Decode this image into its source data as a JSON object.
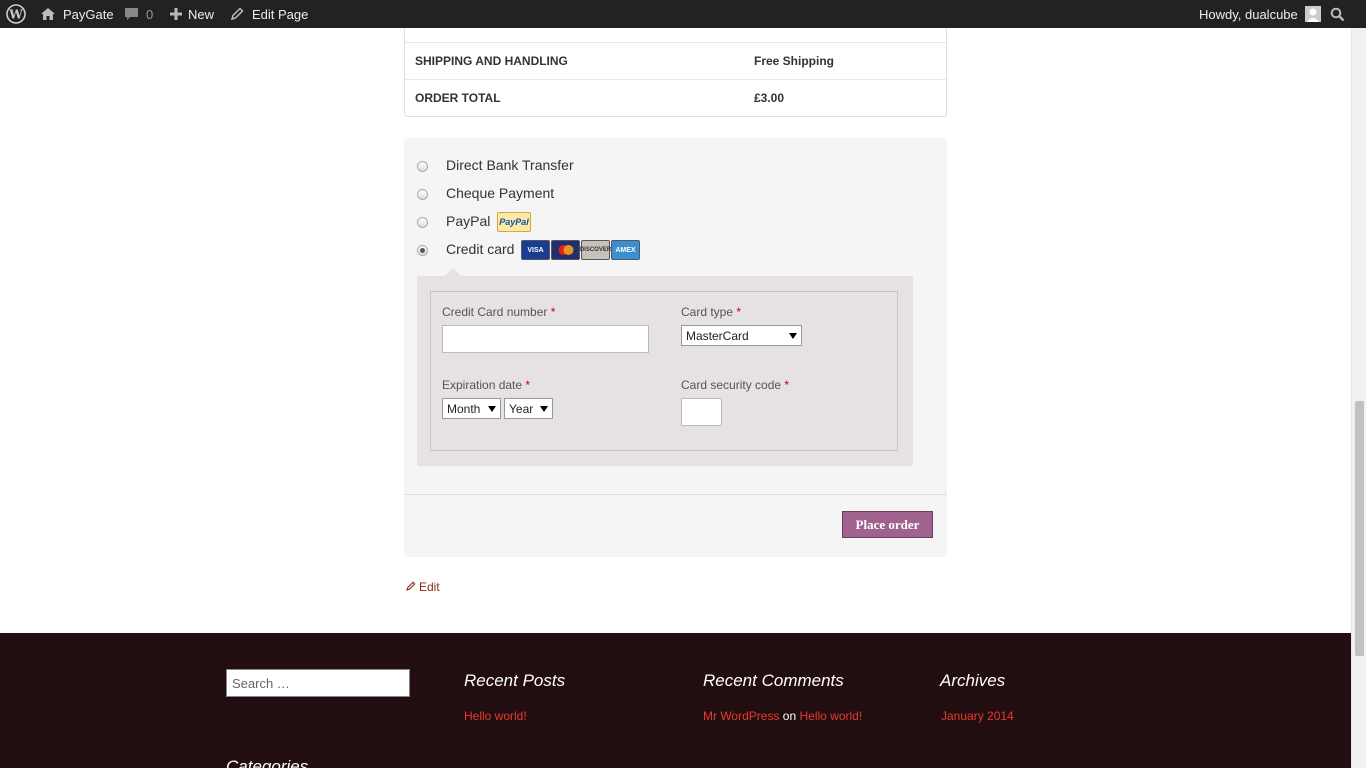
{
  "admin_bar": {
    "site_name": "PayGate",
    "comments_count": "0",
    "new_label": "New",
    "edit_page_label": "Edit Page",
    "greeting": "Howdy, dualcube"
  },
  "order_table": {
    "rows": [
      {
        "label": "SHIPPING AND HANDLING",
        "value": "Free Shipping"
      },
      {
        "label": "ORDER TOTAL",
        "value": "£3.00"
      }
    ]
  },
  "payment": {
    "methods": [
      {
        "label": "Direct Bank Transfer",
        "selected": false
      },
      {
        "label": "Cheque Payment",
        "selected": false
      },
      {
        "label": "PayPal",
        "selected": false
      },
      {
        "label": "Credit card",
        "selected": true
      }
    ],
    "paypal_logo_text": "PayPal",
    "card_logos": [
      "VISA",
      "MC",
      "DISCOVER",
      "AMEX"
    ],
    "credit_card_form": {
      "card_number_label": "Credit Card number",
      "card_number_value": "",
      "card_type_label": "Card type",
      "card_type_value": "MasterCard",
      "expiration_label": "Expiration date",
      "month_value": "Month",
      "year_value": "Year",
      "security_code_label": "Card security code",
      "security_code_value": "",
      "required_mark": "*"
    },
    "place_order_label": "Place order"
  },
  "edit_link_label": "Edit",
  "footer": {
    "search_placeholder": "Search …",
    "recent_posts_title": "Recent Posts",
    "recent_posts": [
      "Hello world!"
    ],
    "recent_comments_title": "Recent Comments",
    "recent_comment": {
      "author": "Mr WordPress",
      "on": "on",
      "post": "Hello world!"
    },
    "archives_title": "Archives",
    "archives": [
      "January 2014"
    ],
    "categories_title": "Categories"
  },
  "colors": {
    "admin_bar_bg": "#222222",
    "footer_bg": "#220e10",
    "place_order_bg": "#a0638f",
    "footer_link": "#e63b2d"
  }
}
